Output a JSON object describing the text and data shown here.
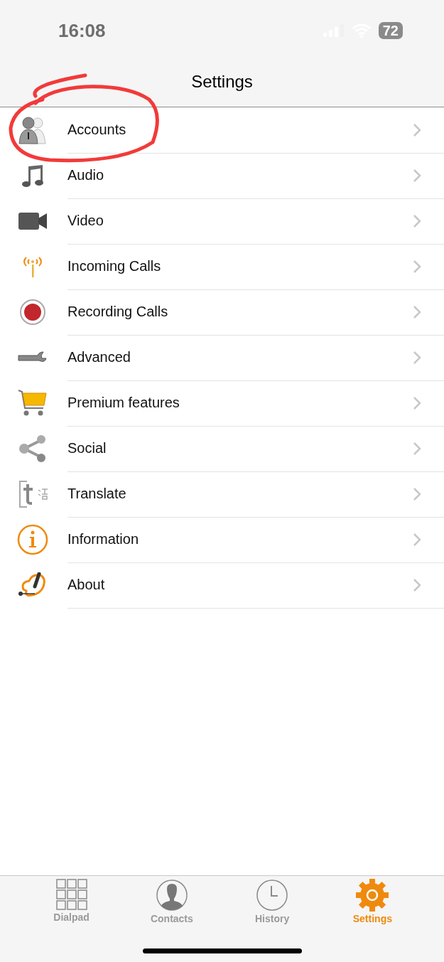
{
  "status_bar": {
    "time": "16:08",
    "battery": "72"
  },
  "header": {
    "title": "Settings"
  },
  "menu": [
    {
      "label": "Accounts"
    },
    {
      "label": "Audio"
    },
    {
      "label": "Video"
    },
    {
      "label": "Incoming Calls"
    },
    {
      "label": "Recording Calls"
    },
    {
      "label": "Advanced"
    },
    {
      "label": "Premium features"
    },
    {
      "label": "Social"
    },
    {
      "label": "Translate"
    },
    {
      "label": "Information"
    },
    {
      "label": "About"
    }
  ],
  "tab_bar": [
    {
      "label": "Dialpad",
      "selected": false
    },
    {
      "label": "Contacts",
      "selected": false
    },
    {
      "label": "History",
      "selected": false
    },
    {
      "label": "Settings",
      "selected": true
    }
  ]
}
